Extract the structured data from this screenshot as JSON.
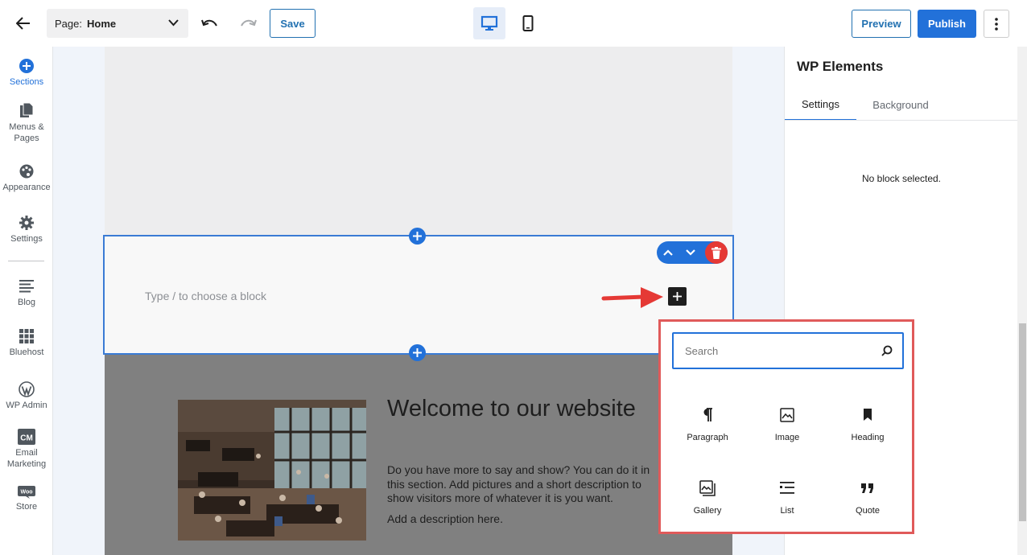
{
  "header": {
    "page_label": "Page:",
    "page_value": "Home",
    "save_label": "Save",
    "preview_label": "Preview",
    "publish_label": "Publish"
  },
  "sidebar": {
    "items": [
      {
        "label": "Sections",
        "icon": "plus-circle-icon",
        "active": true
      },
      {
        "label": "Menus & Pages",
        "icon": "pages-icon"
      },
      {
        "label": "Appearance",
        "icon": "palette-icon"
      },
      {
        "label": "Settings",
        "icon": "gear-icon"
      },
      {
        "label": "Blog",
        "icon": "blog-icon"
      },
      {
        "label": "Bluehost",
        "icon": "grid-icon"
      },
      {
        "label": "WP Admin",
        "icon": "wordpress-icon"
      },
      {
        "label": "Email Marketing",
        "icon": "cm-icon"
      },
      {
        "label": "Store",
        "icon": "woo-icon"
      }
    ]
  },
  "canvas": {
    "block_placeholder": "Type / to choose a block",
    "heading": "Welcome to our website",
    "description": "Do you have more to say and show? You can do it in this section. Add pictures and a short description to show visitors more of whatever it is you want.",
    "description2": "Add a description here."
  },
  "right_panel": {
    "title": "WP Elements",
    "tabs": [
      "Settings",
      "Background"
    ],
    "empty_message": "No block selected."
  },
  "inserter": {
    "search_placeholder": "Search",
    "blocks": [
      {
        "label": "Paragraph",
        "icon": "paragraph-icon"
      },
      {
        "label": "Image",
        "icon": "image-icon"
      },
      {
        "label": "Heading",
        "icon": "bookmark-icon"
      },
      {
        "label": "Gallery",
        "icon": "gallery-icon"
      },
      {
        "label": "List",
        "icon": "list-icon"
      },
      {
        "label": "Quote",
        "icon": "quote-icon"
      }
    ]
  },
  "colors": {
    "accent": "#2271d9",
    "highlight": "#e05a5a",
    "delete": "#e53935"
  }
}
